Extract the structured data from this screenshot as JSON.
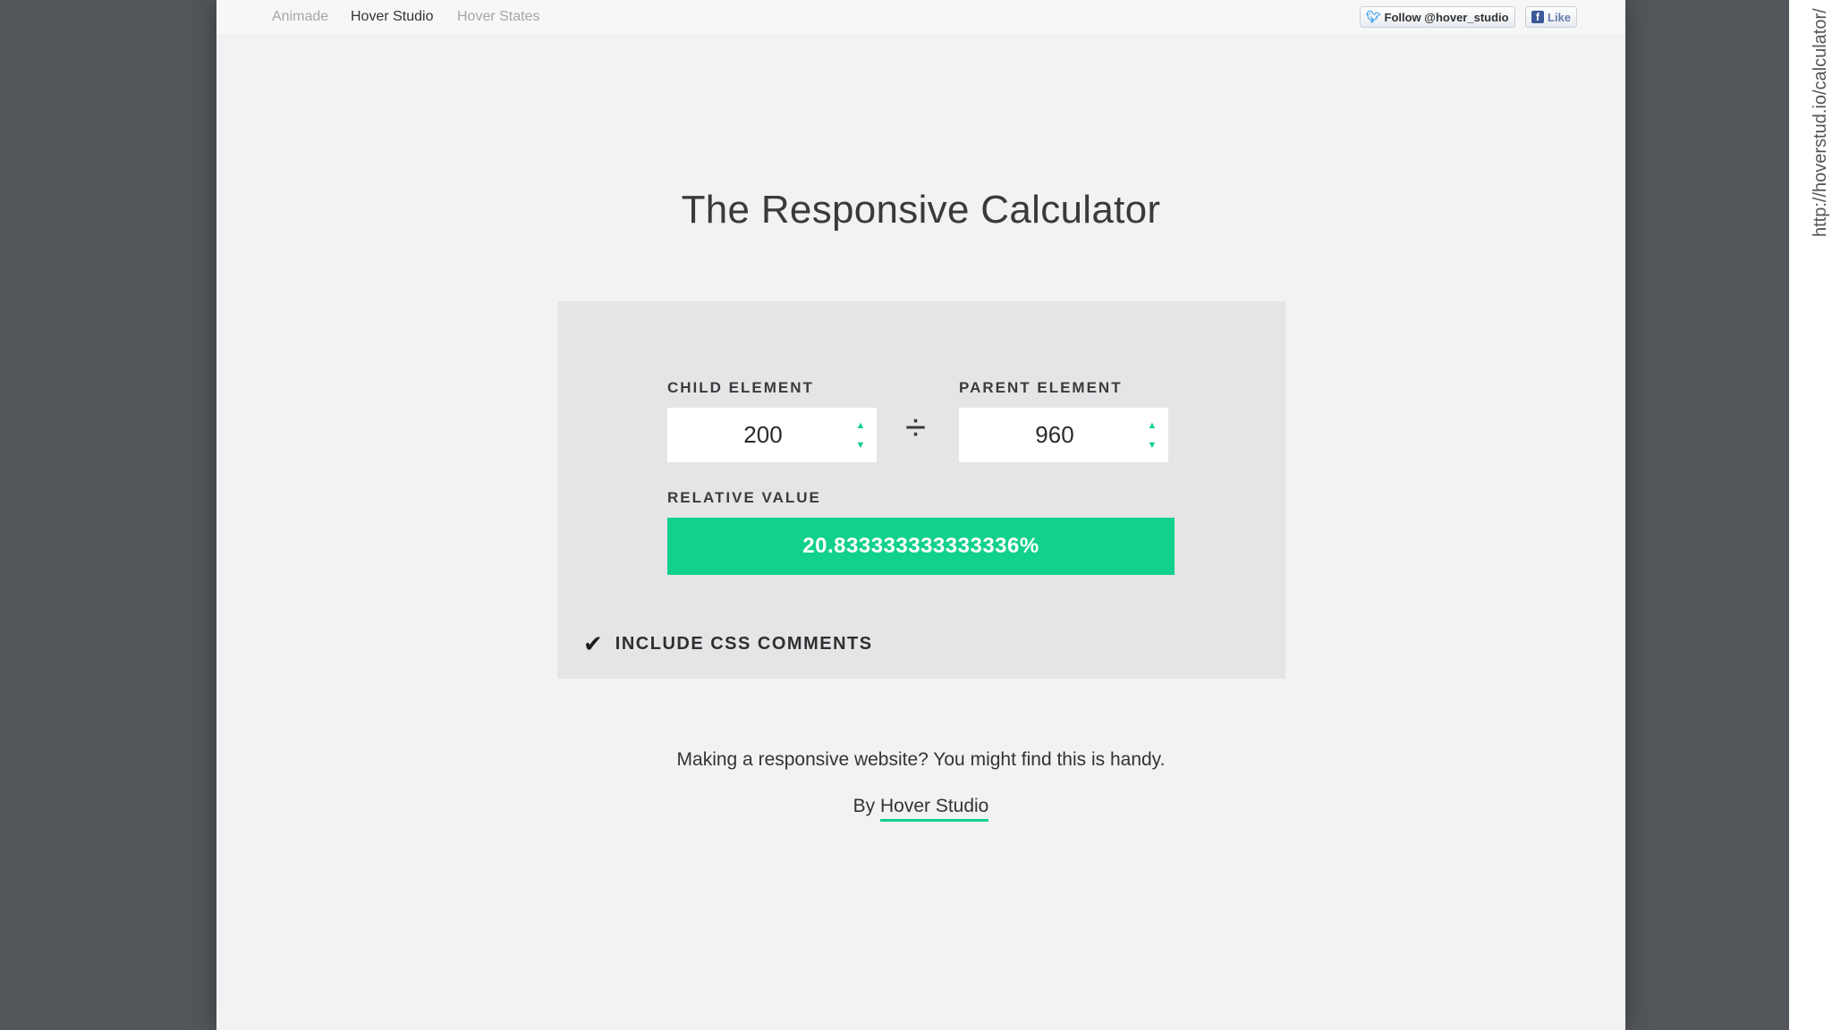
{
  "nav": {
    "links": [
      "Animade",
      "Hover Studio",
      "Hover States"
    ],
    "active": "Hover Studio",
    "twitter_label": "Follow @hover_studio",
    "like_label": "Like"
  },
  "title": "The Responsive Calculator",
  "calculator": {
    "child_label": "CHILD ELEMENT",
    "child_value": "200",
    "operator": "÷",
    "parent_label": "PARENT ELEMENT",
    "parent_value": "960",
    "relative_label": "RELATIVE VALUE",
    "relative_value": "20.833333333333336%",
    "comments_label": "INCLUDE CSS COMMENTS",
    "comments_checked": true
  },
  "footer": {
    "tagline": "Making a responsive website? You might find this is handy.",
    "by_prefix": "By",
    "by_link": "Hover Studio"
  },
  "side_url": "http://hoverstud.io/calculator/",
  "colors": {
    "accent": "#12d18c",
    "page_bg": "#f2f2f4",
    "panel_bg": "#e5e5e8",
    "outer_bg": "#53565a"
  },
  "icons": {
    "twitter": "twitter-bird-icon",
    "facebook": "facebook-f-icon",
    "check": "checkmark-icon",
    "spin_up": "triangle-up-icon",
    "spin_down": "triangle-down-icon"
  }
}
